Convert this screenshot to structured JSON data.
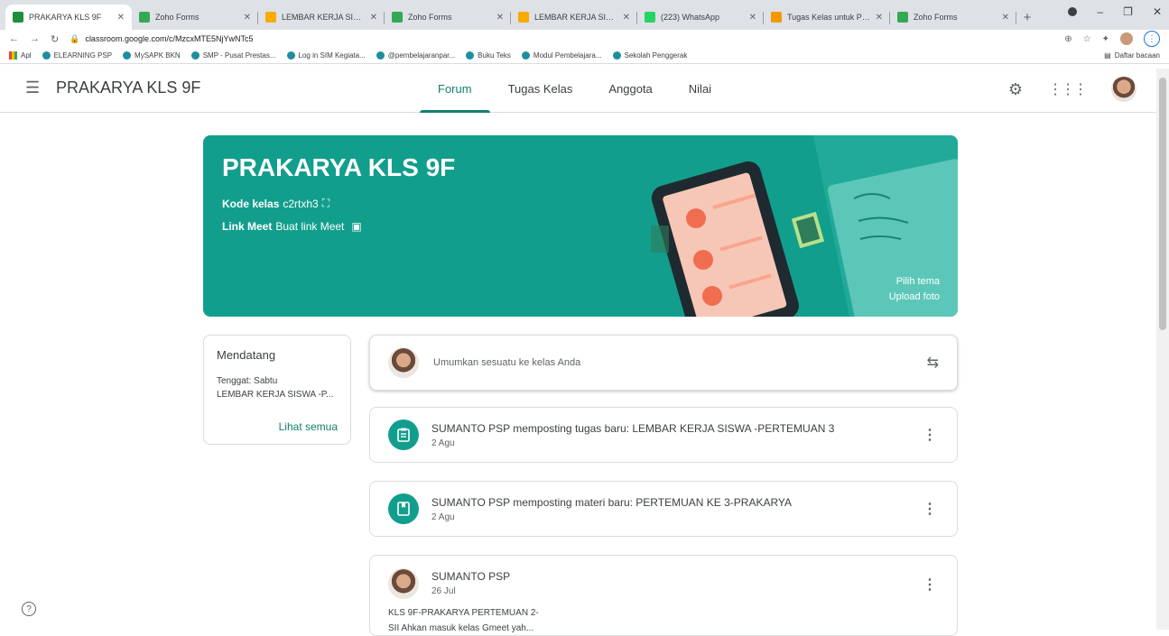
{
  "browser": {
    "tabs": [
      {
        "title": "PRAKARYA KLS 9F",
        "icon_color": "#1e8e3e",
        "active": true
      },
      {
        "title": "Zoho Forms",
        "icon_color": "#34a853",
        "active": false
      },
      {
        "title": "LEMBAR KERJA SISWA-PE",
        "icon_color": "#f9ab00",
        "active": false
      },
      {
        "title": "Zoho Forms",
        "icon_color": "#34a853",
        "active": false
      },
      {
        "title": "LEMBAR KERJA SISWA-PE",
        "icon_color": "#f9ab00",
        "active": false
      },
      {
        "title": "(223) WhatsApp",
        "icon_color": "#25d366",
        "active": false
      },
      {
        "title": "Tugas Kelas untuk PRAKA",
        "icon_color": "#f29900",
        "active": false
      },
      {
        "title": "Zoho Forms",
        "icon_color": "#34a853",
        "active": false
      }
    ],
    "url": "classroom.google.com/c/MzcxMTE5NjYwNTc5",
    "bookmarks": [
      "Apl",
      "ELEARNING PSP",
      "MySAPK BKN",
      "SMP - Pusat Prestas...",
      "Log in SIM Kegiata...",
      "@pembelajaranpar...",
      "Buku Teks",
      "Modul Pembelajara...",
      "Sekolah Penggerak"
    ],
    "reading_list": "Daftar bacaan"
  },
  "header": {
    "title": "PRAKARYA KLS 9F",
    "tabs": [
      {
        "label": "Forum",
        "active": true
      },
      {
        "label": "Tugas Kelas",
        "active": false
      },
      {
        "label": "Anggota",
        "active": false
      },
      {
        "label": "Nilai",
        "active": false
      }
    ]
  },
  "banner": {
    "title": "PRAKARYA KLS 9F",
    "code_label": "Kode kelas",
    "code_value": "c2rtxh3",
    "meet_label": "Link Meet",
    "meet_value": "Buat link Meet",
    "choose_theme": "Pilih tema",
    "upload_photo": "Upload foto",
    "color": "#129e8d"
  },
  "upcoming": {
    "title": "Mendatang",
    "due": "Tenggat: Sabtu",
    "item": "LEMBAR KERJA SISWA -P...",
    "view_all": "Lihat semua"
  },
  "stream": {
    "announce_placeholder": "Umumkan sesuatu ke kelas Anda",
    "posts": [
      {
        "title": "SUMANTO PSP memposting tugas baru: LEMBAR KERJA SISWA -PERTEMUAN 3",
        "date": "2 Agu",
        "icon": "assignment-icon"
      },
      {
        "title": "SUMANTO PSP memposting materi baru: PERTEMUAN KE 3-PRAKARYA",
        "date": "2 Agu",
        "icon": "material-icon"
      }
    ],
    "announcement": {
      "author": "SUMANTO PSP",
      "date": "26 Jul",
      "line1": "KLS 9F-PRAKARYA PERTEMUAN 2-",
      "line2": "SII Ahkan masuk kelas Gmeet yah..."
    }
  }
}
